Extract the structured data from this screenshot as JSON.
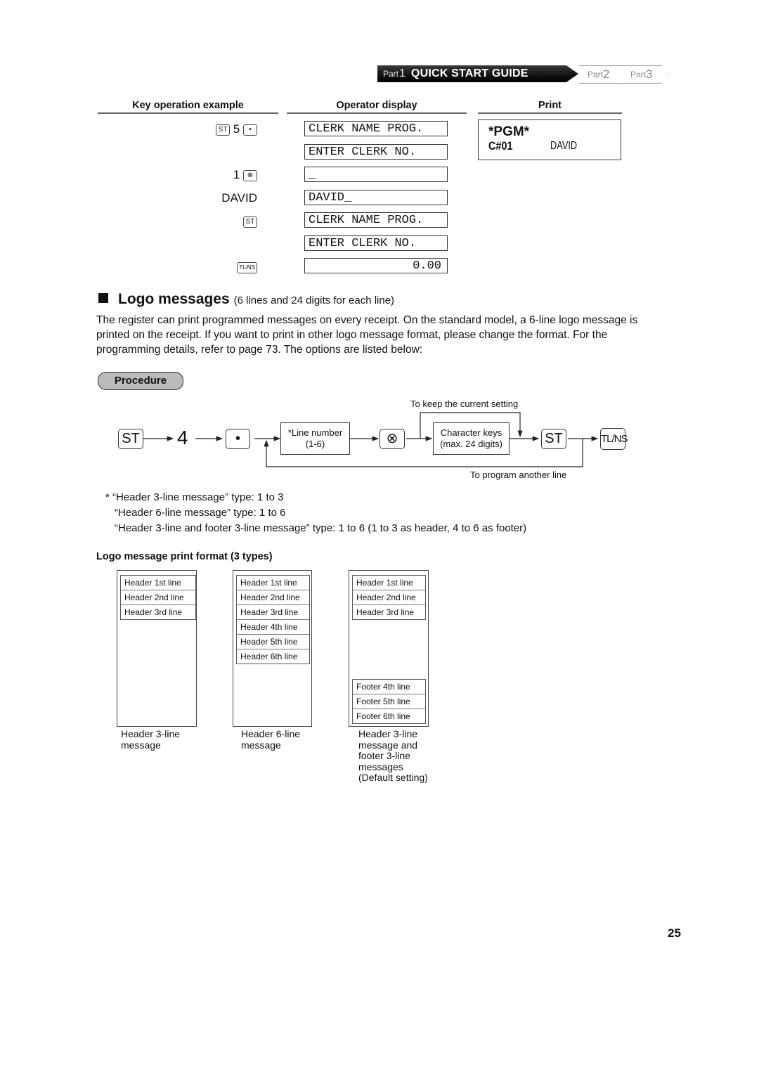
{
  "header": {
    "part_prefix": "Part",
    "active_part_number": "1",
    "active_title": "QUICK START GUIDE",
    "other_parts": [
      {
        "prefix": "Part",
        "number": "2"
      },
      {
        "prefix": "Part",
        "number": "3"
      }
    ]
  },
  "example": {
    "columns": {
      "keys": "Key operation example",
      "display": "Operator display",
      "print": "Print"
    },
    "keys": {
      "row1_key": "ST",
      "row1_digit": "5",
      "row1_key2": "•",
      "row2_digit": "1",
      "row2_key": "⊗",
      "row3_text": "DAVID",
      "row4_key": "ST",
      "row5_key": "TL/NS"
    },
    "display_lines": [
      "CLERK NAME PROG.",
      "ENTER CLERK NO.",
      "_",
      "DAVID_",
      "CLERK NAME PROG.",
      "ENTER CLERK NO.",
      "0.00"
    ],
    "print": {
      "line1": "*PGM*",
      "clerk_code": "C#01",
      "clerk_name": "DAVID"
    }
  },
  "section": {
    "title": "Logo messages",
    "subtitle": "(6 lines and 24 digits for each line)",
    "paragraph": "The register can print programmed messages on every receipt. On the standard model, a 6-line logo message is printed on the receipt.  If you want to print in other logo message format, please change the format. For the programming details, refer to page 73.  The options are listed below:"
  },
  "procedure": {
    "label": "Procedure",
    "st_key": "ST",
    "digit": "4",
    "dot_key": "•",
    "line_number_box": {
      "line1": "*Line number",
      "line2": "(1-6)"
    },
    "multiply_key": "⊗",
    "char_box": {
      "line1": "Character keys",
      "line2": "(max. 24 digits)"
    },
    "st_key2": "ST",
    "tlns_key": "TL/NS",
    "keep_note": "To keep the current setting",
    "another_note": "To program another line"
  },
  "notes": [
    "*  “Header 3-line message” type:  1 to 3",
    "“Header 6-line message” type:  1 to 6",
    "“Header 3-line and footer 3-line message” type: 1 to 6 (1 to 3 as header, 4 to 6 as footer)"
  ],
  "formats": {
    "title": "Logo message print format (3 types)",
    "types": [
      {
        "header_lines": [
          "Header 1st line",
          "Header 2nd line",
          "Header 3rd line"
        ],
        "footer_lines": [],
        "caption": [
          "Header 3-line",
          "message"
        ]
      },
      {
        "header_lines": [
          "Header 1st line",
          "Header 2nd line",
          "Header 3rd line",
          "Header 4th line",
          "Header 5th line",
          "Header 6th line"
        ],
        "footer_lines": [],
        "caption": [
          "Header 6-line",
          "message"
        ]
      },
      {
        "header_lines": [
          "Header 1st line",
          "Header 2nd line",
          "Header 3rd line"
        ],
        "footer_lines": [
          "Footer 4th line",
          "Footer 5th line",
          "Footer 6th line"
        ],
        "caption": [
          "Header 3-line",
          "message and",
          "footer 3-line",
          "messages",
          "(Default setting)"
        ]
      }
    ]
  },
  "page_number": "25"
}
